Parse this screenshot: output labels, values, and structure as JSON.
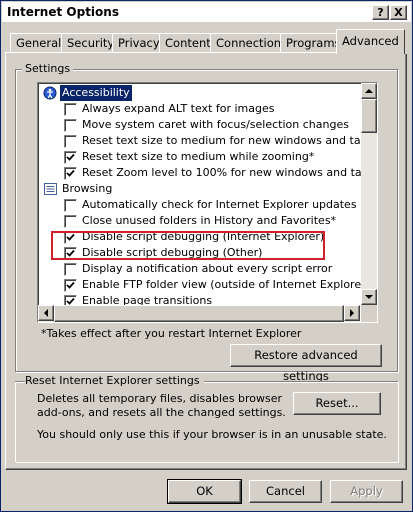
{
  "window": {
    "title": "Internet Options",
    "help_label": "?",
    "close_label": "X"
  },
  "tabs": [
    {
      "label": "General"
    },
    {
      "label": "Security"
    },
    {
      "label": "Privacy"
    },
    {
      "label": "Content"
    },
    {
      "label": "Connections"
    },
    {
      "label": "Programs"
    },
    {
      "label": "Advanced",
      "active": true
    }
  ],
  "settings": {
    "group_label": "Settings",
    "items": [
      {
        "type": "category",
        "label": "Accessibility",
        "icon": "accessibility-icon",
        "selected": true
      },
      {
        "type": "check",
        "label": "Always expand ALT text for images",
        "checked": false
      },
      {
        "type": "check",
        "label": "Move system caret with focus/selection changes",
        "checked": false
      },
      {
        "type": "check",
        "label": "Reset text size to medium for new windows and tabs",
        "checked": false
      },
      {
        "type": "check",
        "label": "Reset text size to medium while zooming*",
        "checked": true
      },
      {
        "type": "check",
        "label": "Reset Zoom level to 100% for new windows and tabs",
        "checked": true
      },
      {
        "type": "category",
        "label": "Browsing",
        "icon": "browsing-icon"
      },
      {
        "type": "check",
        "label": "Automatically check for Internet Explorer updates",
        "checked": false
      },
      {
        "type": "check",
        "label": "Close unused folders in History and Favorites*",
        "checked": false
      },
      {
        "type": "check",
        "label": "Disable script debugging (Internet Explorer)",
        "checked": true
      },
      {
        "type": "check",
        "label": "Disable script debugging (Other)",
        "checked": true
      },
      {
        "type": "check",
        "label": "Display a notification about every script error",
        "checked": false
      },
      {
        "type": "check",
        "label": "Enable FTP folder view (outside of Internet Explorer)",
        "checked": true
      },
      {
        "type": "check",
        "label": "Enable page transitions",
        "checked": true
      }
    ],
    "scroll_position": 0.0,
    "footnote": "*Takes effect after you restart Internet Explorer",
    "restore_button": "Restore advanced settings"
  },
  "reset": {
    "group_label": "Reset Internet Explorer settings",
    "description_line1": "Deletes all temporary files, disables browser",
    "description_line2": "add-ons, and resets all the changed settings.",
    "reset_button": "Reset...",
    "warning": "You should only use this if your browser is in an unusable state."
  },
  "dialog_buttons": {
    "ok": "OK",
    "cancel": "Cancel",
    "apply": "Apply"
  },
  "colors": {
    "highlight_border": "#d0202a",
    "selection": "#0a246a"
  }
}
